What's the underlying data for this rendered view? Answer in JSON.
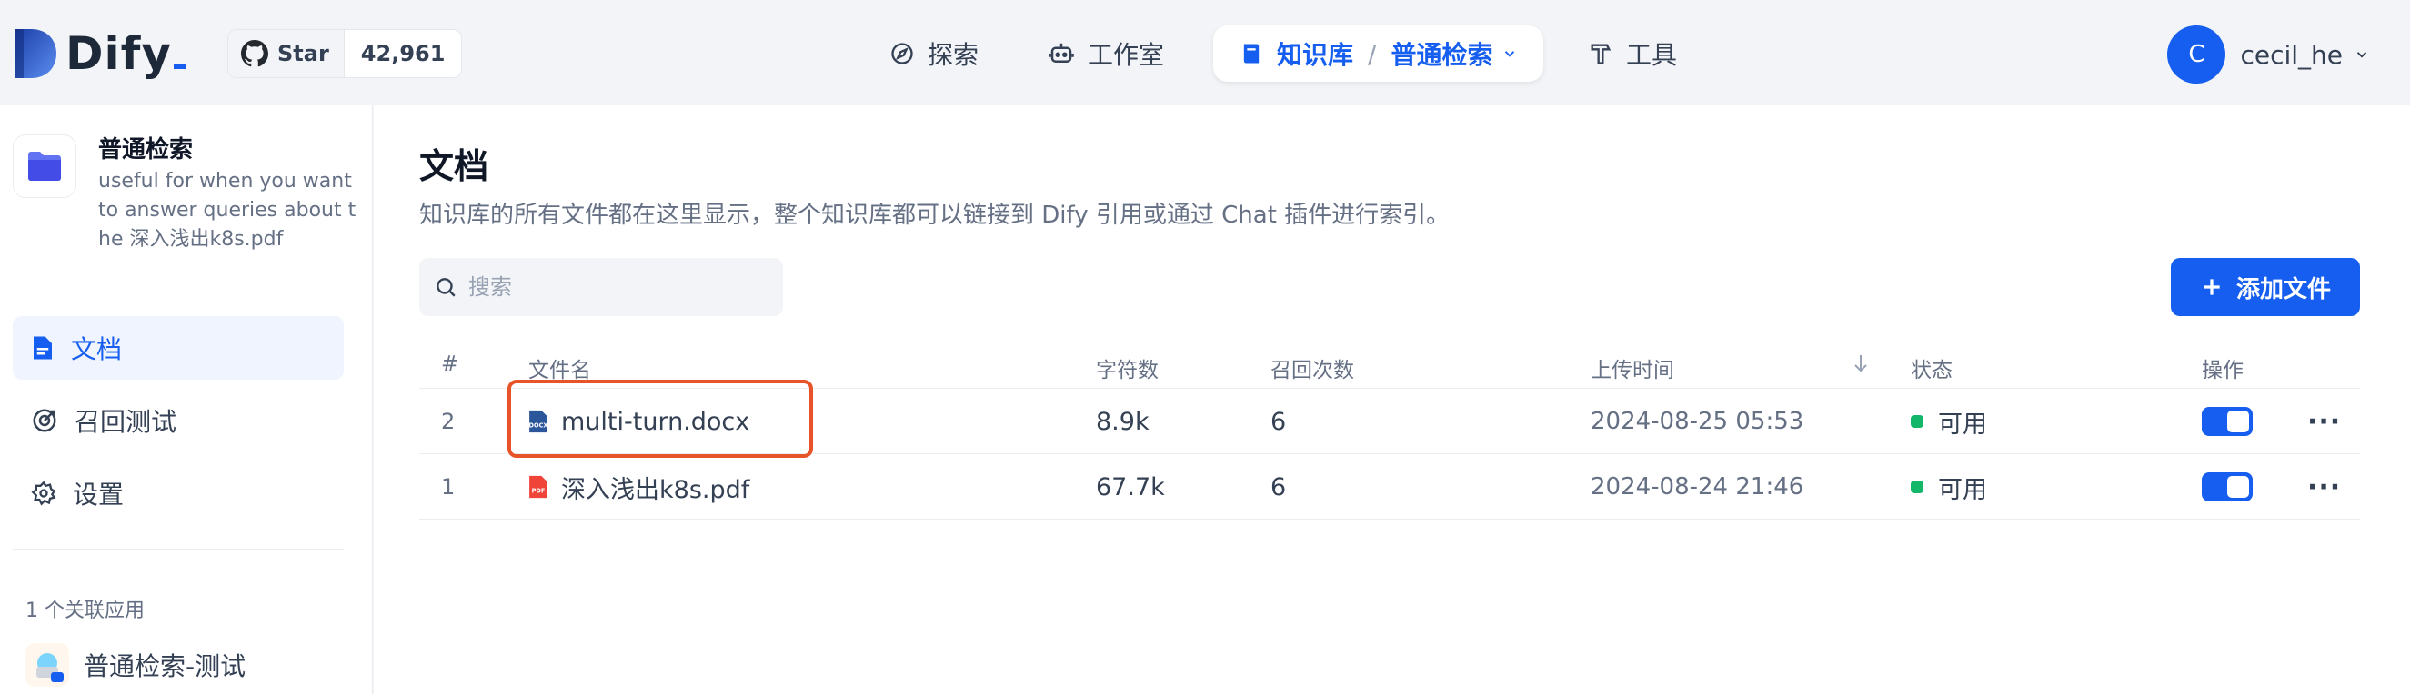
{
  "header": {
    "logo_text": "Dify",
    "github": {
      "star_label": "Star",
      "star_count": "42,961"
    },
    "nav": {
      "explore": "探索",
      "studio": "工作室",
      "knowledge": "知识库",
      "dataset": "普通检索",
      "tools": "工具"
    },
    "user": {
      "initial": "C",
      "name": "cecil_he"
    }
  },
  "sidebar": {
    "dataset_name": "普通检索",
    "dataset_desc": "useful for when you want to answer queries about the 深入浅出k8s.pdf",
    "menu": {
      "documents": "文档",
      "hit_testing": "召回测试",
      "settings": "设置"
    },
    "related_label": "1 个关联应用",
    "related_app": "普通检索-测试"
  },
  "main": {
    "title": "文档",
    "description": "知识库的所有文件都在这里显示，整个知识库都可以链接到 Dify 引用或通过 Chat 插件进行索引。",
    "search_placeholder": "搜索",
    "add_button": "添加文件",
    "columns": {
      "index": "#",
      "name": "文件名",
      "chars": "字符数",
      "hits": "召回次数",
      "upload_time": "上传时间",
      "status": "状态",
      "actions": "操作"
    },
    "rows": [
      {
        "index": "2",
        "name": "multi-turn.docx",
        "type": "docx",
        "chars": "8.9k",
        "hits": "6",
        "upload_time": "2024-08-25 05:53",
        "status": "可用",
        "enabled": true
      },
      {
        "index": "1",
        "name": "深入浅出k8s.pdf",
        "type": "pdf",
        "chars": "67.7k",
        "hits": "6",
        "upload_time": "2024-08-24 21:46",
        "status": "可用",
        "enabled": true
      }
    ],
    "more_label": "···"
  },
  "colors": {
    "primary": "#155eef",
    "status_available": "#12b76a",
    "highlight": "#e8542a",
    "docx_icon": "#2b579a",
    "pdf_icon": "#f04438"
  }
}
